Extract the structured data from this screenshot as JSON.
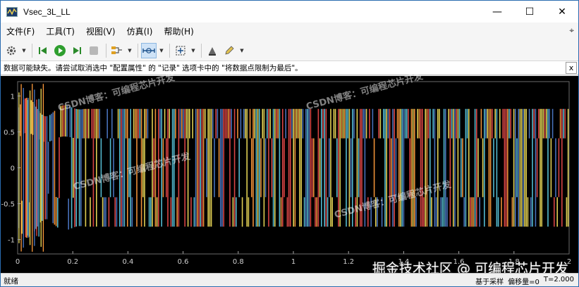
{
  "window": {
    "title": "Vsec_3L_LL",
    "minimize": "—",
    "maximize": "☐",
    "close": "✕"
  },
  "menu": [
    "文件(F)",
    "工具(T)",
    "视图(V)",
    "仿真(I)",
    "帮助(H)"
  ],
  "toolbar_icons": [
    "gear-icon",
    "step-back-icon",
    "run-icon",
    "step-forward-icon",
    "stop-icon",
    "signal-select-icon",
    "zoom-time-icon",
    "fit-icon",
    "highlight-icon",
    "edit-icon"
  ],
  "info": {
    "message": "数据可能缺失。请尝试取消选中 \"配置属性\" 的 \"记录\" 选项卡中的 \"将数据点限制为最后\"。",
    "close": "x"
  },
  "watermarks": [
    "CSDN博客：可编程芯片开发",
    "CSDN博客：可编程芯片开发",
    "CSDN博客：可编程芯片开发",
    "CSDN博客：可编程芯片开发"
  ],
  "brand_watermark": "掘金技术社区 @ 可编程芯片开发",
  "status": {
    "left": "就绪",
    "sample": "基于采样",
    "offset": "偏移量=0",
    "time": "T=2.000"
  },
  "chart_data": {
    "type": "line",
    "xlim": [
      0,
      2
    ],
    "ylim": [
      -1.2,
      1.2
    ],
    "x_ticks": [
      "0",
      "0.2",
      "0.4",
      "0.6",
      "0.8",
      "1",
      "1.2",
      "1.4",
      "1.6",
      "1.8",
      "2"
    ],
    "y_ticks": [
      "1",
      "0.5",
      "0",
      "-0.5",
      "-1"
    ],
    "y_tick_values": [
      1,
      0.5,
      0,
      -0.5,
      -1
    ],
    "levels": [
      0.82,
      0.41,
      0,
      -0.41,
      -0.82
    ],
    "series_colors": [
      "#f2e05a",
      "#ff9b3c",
      "#4d7ac8",
      "#e84a4a",
      "#5ac8e0"
    ],
    "background": "#000000",
    "grid": false
  }
}
